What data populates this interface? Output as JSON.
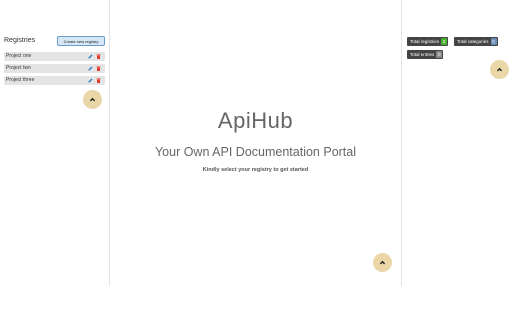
{
  "sidebar": {
    "title": "Registries",
    "create_label": "Create new registry",
    "items": [
      {
        "label": "Project one"
      },
      {
        "label": "Project two"
      },
      {
        "label": "Project three"
      }
    ]
  },
  "main": {
    "title": "ApiHub",
    "subtitle": "Your Own API Documentation Portal",
    "hint": "Kindly select your registry to get started"
  },
  "stats": {
    "registries": {
      "label": "Total registries",
      "count": "3",
      "color": "#4caf32"
    },
    "categories": {
      "label": "Total categories",
      "count": "0",
      "color": "#6a8fb5"
    },
    "entries": {
      "label": "Total entries",
      "count": "0",
      "color": "#8a8a8a"
    }
  },
  "colors": {
    "fab": "#ead6a6",
    "edit_icon": "#2f7fc7",
    "delete_icon": "#e53935"
  }
}
